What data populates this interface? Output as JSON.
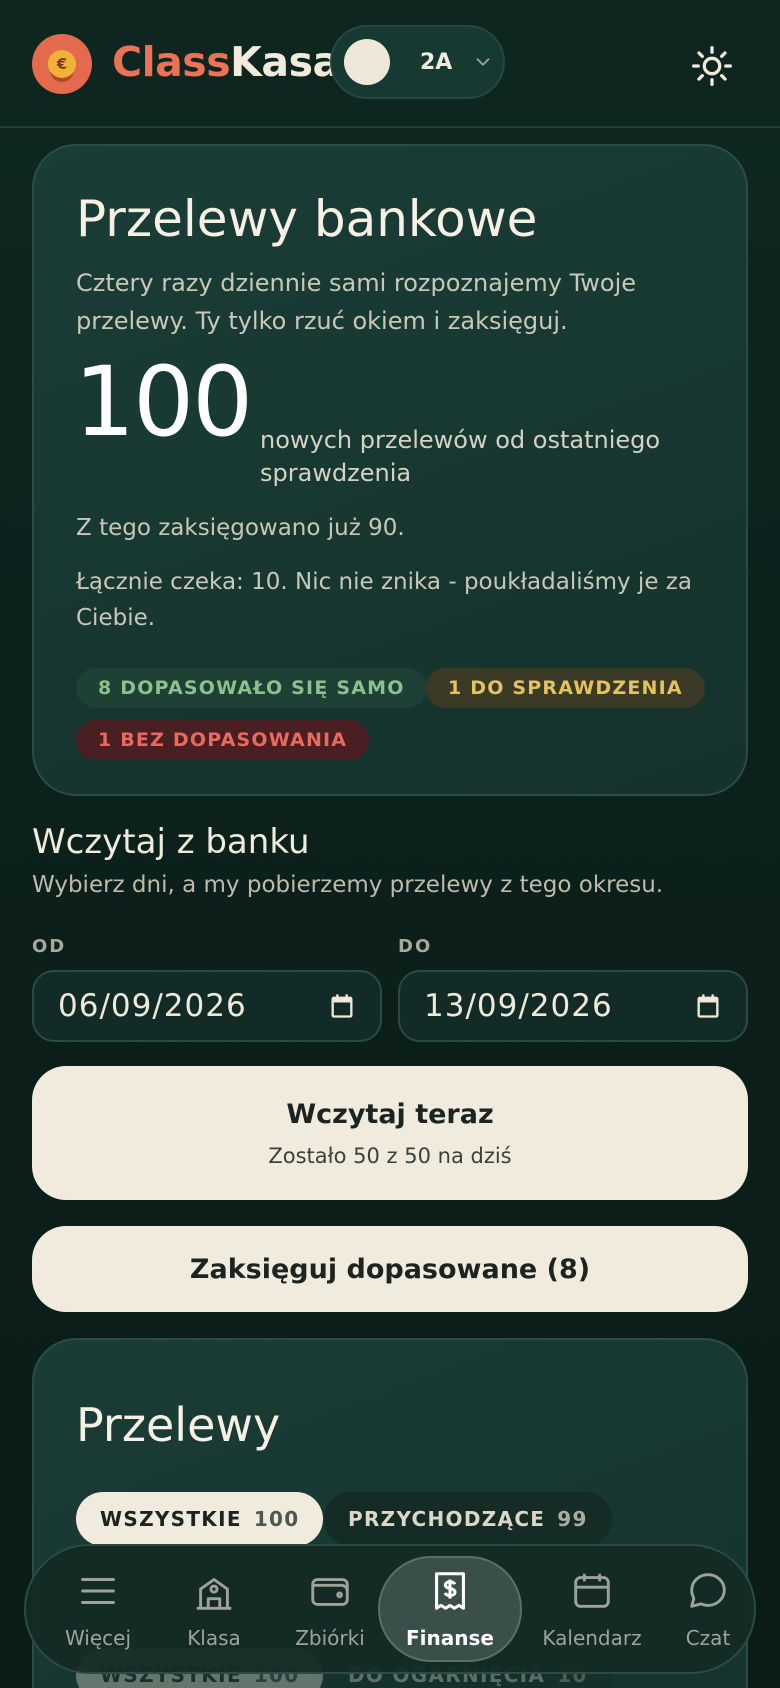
{
  "header": {
    "brand_part1": "Class",
    "brand_part2": "Kasa",
    "logo_glyph": "€",
    "class_name": "2A"
  },
  "bank_card": {
    "title": "Przelewy bankowe",
    "description": "Cztery razy dziennie sami rozpoznajemy Twoje przelewy. Ty tylko rzuć okiem i zaksięguj.",
    "new_count": "100",
    "new_count_label": "nowych przelewów od ostatniego sprawdzenia",
    "booked_text": "Z tego zaksięgowano już 90.",
    "waiting_text": "Łącznie czeka: 10. Nic nie znika - poukładaliśmy je za Ciebie.",
    "badges": {
      "matched": "8 DOPASOWAŁO SIĘ SAMO",
      "to_check": "1 DO SPRAWDZENIA",
      "unmatched": "1 BEZ DOPASOWANIA"
    },
    "colors": {
      "matched": "#8cc08e",
      "to_check": "#e6c25f",
      "unmatched": "#e86a5d"
    }
  },
  "import_section": {
    "title": "Wczytaj z banku",
    "subtitle": "Wybierz dni, a my pobierzemy przelewy z tego okresu.",
    "from_label": "OD",
    "to_label": "DO",
    "from_value": "06/09/2026",
    "to_value": "13/09/2026",
    "load_button_label": "Wczytaj teraz",
    "load_button_sub": "Zostało 50 z 50 na dziś",
    "book_button_label": "Zaksięguj dopasowane (8)"
  },
  "transfers_card": {
    "title": "Przelewy",
    "filters_row1": [
      {
        "label": "WSZYSTKIE",
        "count": "100"
      },
      {
        "label": "PRZYCHODZĄCE",
        "count": "99"
      }
    ],
    "filters_row2": [
      {
        "label": "WSZYSTKIE",
        "count": "100"
      },
      {
        "label": "DO OGARNIĘCIA",
        "count": "10"
      }
    ]
  },
  "bottom_nav": {
    "items": [
      {
        "label": "Więcej",
        "icon": "menu-icon"
      },
      {
        "label": "Klasa",
        "icon": "school-icon"
      },
      {
        "label": "Zbiórki",
        "icon": "wallet-icon"
      },
      {
        "label": "Finanse",
        "icon": "receipt-dollar-icon"
      },
      {
        "label": "Kalendarz",
        "icon": "calendar-icon"
      },
      {
        "label": "Czat",
        "icon": "chat-bubble-icon"
      }
    ],
    "active": "Finanse"
  },
  "accent_colors": {
    "brand_coral": "#ea7356",
    "background": "#0f2721",
    "button_cream": "#f1ebdd"
  }
}
